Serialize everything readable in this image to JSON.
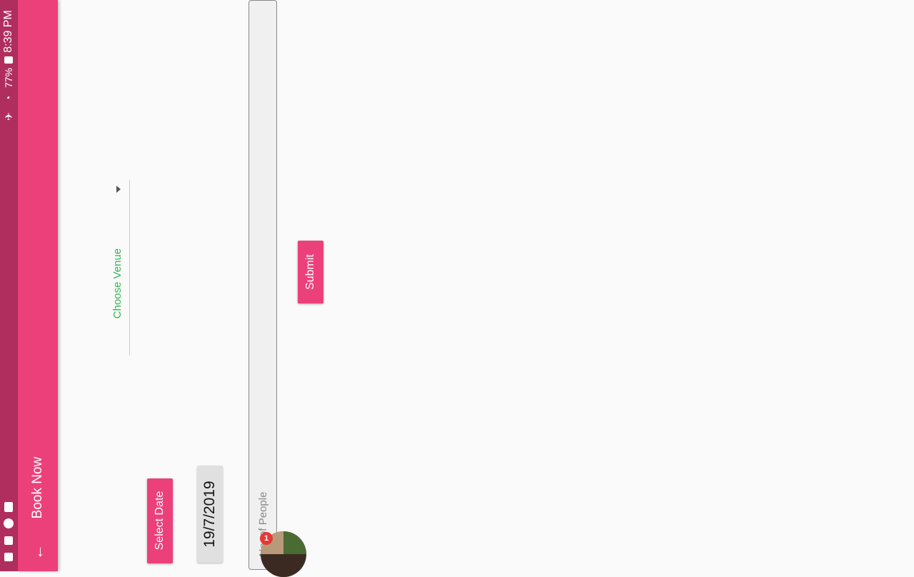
{
  "status_bar": {
    "time": "8:39 PM",
    "battery": "77%"
  },
  "toolbar": {
    "title": "Book Now"
  },
  "form": {
    "venue_label": "Choose Venue",
    "select_date_label": "Select Date",
    "date_value": "19/7/2019",
    "people_placeholder": "No. of People",
    "submit_label": "Submit"
  },
  "chat_head": {
    "badge_count": "1"
  },
  "colors": {
    "accent": "#ec407a",
    "status_bar": "#b02e5e",
    "venue_label": "#2db84d"
  }
}
